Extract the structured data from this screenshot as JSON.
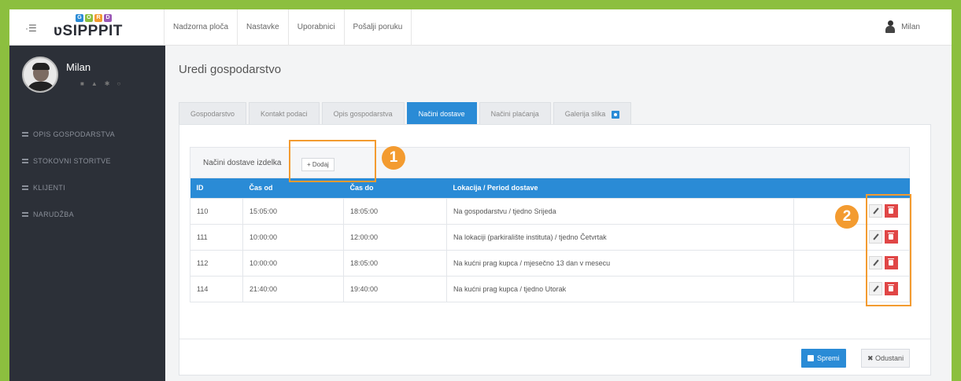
{
  "topbar": {
    "logo_letters": [
      "G",
      "O",
      "R",
      "D"
    ],
    "brand": "ʋSIPPPIT",
    "nav": [
      "Nadzorna ploča",
      "Nastavke",
      "Uporabnici",
      "Pošalji poruku"
    ],
    "user": "Milan"
  },
  "sidebar": {
    "user_name": "Milan",
    "items": [
      "OPIS GOSPODARSTVA",
      "STOKOVNI STORITVE",
      "KLIJENTI",
      "NARUDŽBA"
    ]
  },
  "main": {
    "title": "Uredi gospodarstvo",
    "tabs": [
      "Gospodarstvo",
      "Kontakt podaci",
      "Opis gospodarstva",
      "Načini dostave",
      "Načini plaćanja",
      "Galerija slika"
    ],
    "active_tab": "Načini dostave",
    "section_title": "Načini dostave izdelka",
    "add_label": "+ Dodaj",
    "columns": [
      "ID",
      "Čas od",
      "Čas do",
      "Lokacija / Period dostave",
      ""
    ],
    "rows": [
      {
        "id": "110",
        "from": "15:05:00",
        "to": "18:05:00",
        "location": "Na gospodarstvu / tjedno Srijeda"
      },
      {
        "id": "111",
        "from": "10:00:00",
        "to": "12:00:00",
        "location": "Na lokaciji (parkiralište instituta) / tjedno Četvrtak"
      },
      {
        "id": "112",
        "from": "10:00:00",
        "to": "18:05:00",
        "location": "Na kućni prag kupca / mjesečno 13 dan v mesecu"
      },
      {
        "id": "114",
        "from": "21:40:00",
        "to": "19:40:00",
        "location": "Na kućni prag kupca / tjedno Utorak"
      }
    ],
    "save_label": "Spremi",
    "cancel_label": "✖ Odustani"
  },
  "callouts": [
    "1",
    "2"
  ],
  "colors": {
    "accent": "#2a8bd6",
    "callout": "#f39b30",
    "danger": "#e04646",
    "frame": "#8cbf3f",
    "sidebar": "#2c3038"
  }
}
